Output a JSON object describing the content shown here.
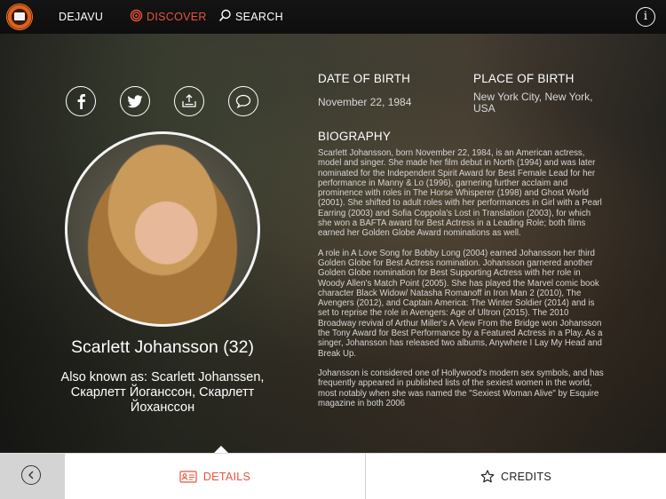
{
  "nav": {
    "dejavu_label": "DEJAVU",
    "discover_label": "DISCOVER",
    "search_label": "SEARCH",
    "info_label": "i"
  },
  "person": {
    "name": "Scarlett Johansson (32)",
    "aka": "Also known as: Scarlett Johanssen, Скарлетт Йоганссон, Скарлетт Йоханссон",
    "dob_label": "DATE OF BIRTH",
    "dob": "November 22, 1984",
    "pob_label": "PLACE OF BIRTH",
    "pob": "New York City, New York, USA",
    "bio_label": "BIOGRAPHY",
    "bio": [
      "Scarlett Johansson, born November 22, 1984, is an American actress, model and singer. She made her film debut in North (1994) and was later nominated for the Independent Spirit Award for Best Female Lead for her performance in Manny & Lo (1996), garnering further acclaim and prominence with roles in The Horse Whisperer (1998) and Ghost World (2001). She shifted to adult roles with her performances in Girl with a Pearl Earring (2003) and Sofia Coppola's Lost in Translation (2003), for which she won a BAFTA award for Best Actress in a Leading Role; both films earned her Golden Globe Award nominations as well.",
      "A role in A Love Song for Bobby Long (2004) earned Johansson her third Golden Globe for Best Actress nomination. Johansson garnered another Golden Globe nomination for Best Supporting Actress with her role in Woody Allen's Match Point (2005). She has played the Marvel comic book character Black Widow/ Natasha Romanoff in Iron Man 2 (2010), The Avengers (2012), and Captain America: The Winter Soldier (2014) and is set to reprise the role in Avengers: Age of Ultron (2015). The 2010 Broadway revival of Arthur Miller's A View From the Bridge won Johansson the Tony Award for Best Performance by a Featured Actress in a Play. As a singer, Johansson has released two albums, Anywhere I Lay My Head and Break Up.",
      "Johansson is considered one of Hollywood's modern sex symbols, and has frequently appeared in published lists of the sexiest women in the world, most notably when she was named the \"Sexiest Woman Alive\" by Esquire magazine in both 2006"
    ]
  },
  "tabs": {
    "details_label": "DETAILS",
    "credits_label": "CREDITS"
  },
  "colors": {
    "accent": "#e8533a"
  }
}
